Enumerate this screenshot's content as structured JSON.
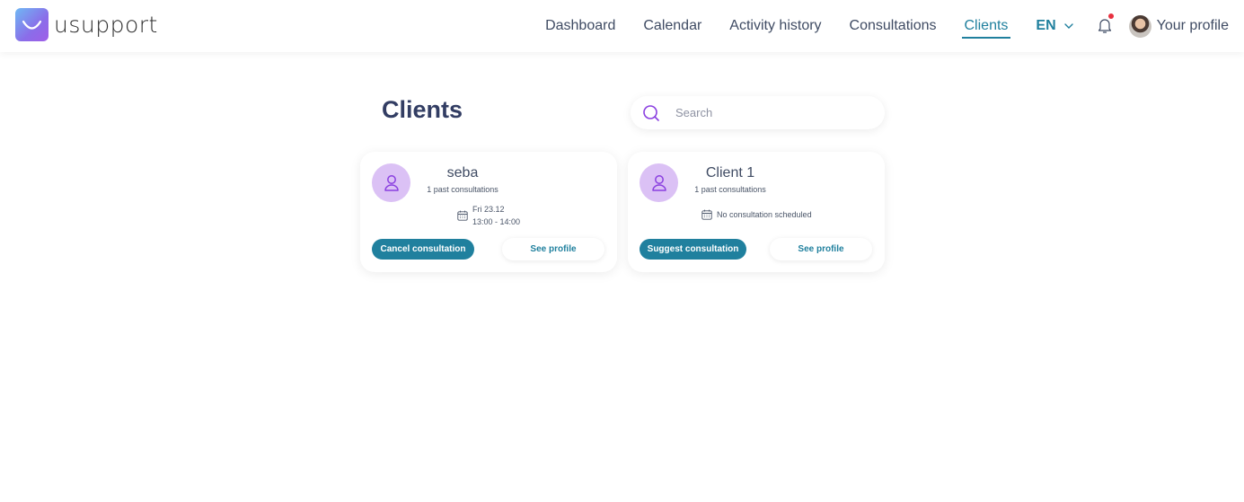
{
  "brand": {
    "name": "usupport"
  },
  "nav": {
    "items": [
      {
        "label": "Dashboard",
        "active": false
      },
      {
        "label": "Calendar",
        "active": false
      },
      {
        "label": "Activity history",
        "active": false
      },
      {
        "label": "Consultations",
        "active": false
      },
      {
        "label": "Clients",
        "active": true
      }
    ],
    "language": "EN",
    "profile_label": "Your profile",
    "has_notification": true
  },
  "page": {
    "title": "Clients"
  },
  "search": {
    "placeholder": "Search",
    "value": ""
  },
  "clients": [
    {
      "name": "seba",
      "past": "1 past consultations",
      "schedule_line1": "Fri 23.12",
      "schedule_line2": "13:00 - 14:00",
      "primary_action": "Cancel consultation",
      "secondary_action": "See profile"
    },
    {
      "name": "Client 1",
      "past": "1 past consultations",
      "schedule_line1": "No consultation scheduled",
      "primary_action": "Suggest consultation",
      "secondary_action": "See profile"
    }
  ],
  "colors": {
    "accent": "#20809e",
    "title": "#323d63",
    "avatar_bg": "#dbc1f5",
    "icon_purple": "#8a3fe0",
    "notification_dot": "#e8303f"
  }
}
